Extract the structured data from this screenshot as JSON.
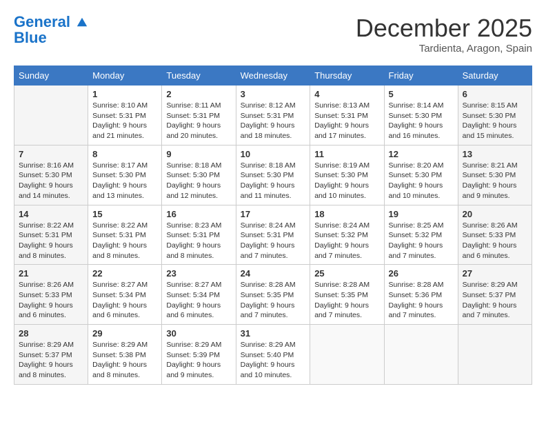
{
  "header": {
    "logo_line1": "General",
    "logo_line2": "Blue",
    "month": "December 2025",
    "location": "Tardienta, Aragon, Spain"
  },
  "weekdays": [
    "Sunday",
    "Monday",
    "Tuesday",
    "Wednesday",
    "Thursday",
    "Friday",
    "Saturday"
  ],
  "weeks": [
    [
      {
        "day": "",
        "sunrise": "",
        "sunset": "",
        "daylight": ""
      },
      {
        "day": "1",
        "sunrise": "Sunrise: 8:10 AM",
        "sunset": "Sunset: 5:31 PM",
        "daylight": "Daylight: 9 hours and 21 minutes."
      },
      {
        "day": "2",
        "sunrise": "Sunrise: 8:11 AM",
        "sunset": "Sunset: 5:31 PM",
        "daylight": "Daylight: 9 hours and 20 minutes."
      },
      {
        "day": "3",
        "sunrise": "Sunrise: 8:12 AM",
        "sunset": "Sunset: 5:31 PM",
        "daylight": "Daylight: 9 hours and 18 minutes."
      },
      {
        "day": "4",
        "sunrise": "Sunrise: 8:13 AM",
        "sunset": "Sunset: 5:31 PM",
        "daylight": "Daylight: 9 hours and 17 minutes."
      },
      {
        "day": "5",
        "sunrise": "Sunrise: 8:14 AM",
        "sunset": "Sunset: 5:30 PM",
        "daylight": "Daylight: 9 hours and 16 minutes."
      },
      {
        "day": "6",
        "sunrise": "Sunrise: 8:15 AM",
        "sunset": "Sunset: 5:30 PM",
        "daylight": "Daylight: 9 hours and 15 minutes."
      }
    ],
    [
      {
        "day": "7",
        "sunrise": "Sunrise: 8:16 AM",
        "sunset": "Sunset: 5:30 PM",
        "daylight": "Daylight: 9 hours and 14 minutes."
      },
      {
        "day": "8",
        "sunrise": "Sunrise: 8:17 AM",
        "sunset": "Sunset: 5:30 PM",
        "daylight": "Daylight: 9 hours and 13 minutes."
      },
      {
        "day": "9",
        "sunrise": "Sunrise: 8:18 AM",
        "sunset": "Sunset: 5:30 PM",
        "daylight": "Daylight: 9 hours and 12 minutes."
      },
      {
        "day": "10",
        "sunrise": "Sunrise: 8:18 AM",
        "sunset": "Sunset: 5:30 PM",
        "daylight": "Daylight: 9 hours and 11 minutes."
      },
      {
        "day": "11",
        "sunrise": "Sunrise: 8:19 AM",
        "sunset": "Sunset: 5:30 PM",
        "daylight": "Daylight: 9 hours and 10 minutes."
      },
      {
        "day": "12",
        "sunrise": "Sunrise: 8:20 AM",
        "sunset": "Sunset: 5:30 PM",
        "daylight": "Daylight: 9 hours and 10 minutes."
      },
      {
        "day": "13",
        "sunrise": "Sunrise: 8:21 AM",
        "sunset": "Sunset: 5:30 PM",
        "daylight": "Daylight: 9 hours and 9 minutes."
      }
    ],
    [
      {
        "day": "14",
        "sunrise": "Sunrise: 8:22 AM",
        "sunset": "Sunset: 5:31 PM",
        "daylight": "Daylight: 9 hours and 8 minutes."
      },
      {
        "day": "15",
        "sunrise": "Sunrise: 8:22 AM",
        "sunset": "Sunset: 5:31 PM",
        "daylight": "Daylight: 9 hours and 8 minutes."
      },
      {
        "day": "16",
        "sunrise": "Sunrise: 8:23 AM",
        "sunset": "Sunset: 5:31 PM",
        "daylight": "Daylight: 9 hours and 8 minutes."
      },
      {
        "day": "17",
        "sunrise": "Sunrise: 8:24 AM",
        "sunset": "Sunset: 5:31 PM",
        "daylight": "Daylight: 9 hours and 7 minutes."
      },
      {
        "day": "18",
        "sunrise": "Sunrise: 8:24 AM",
        "sunset": "Sunset: 5:32 PM",
        "daylight": "Daylight: 9 hours and 7 minutes."
      },
      {
        "day": "19",
        "sunrise": "Sunrise: 8:25 AM",
        "sunset": "Sunset: 5:32 PM",
        "daylight": "Daylight: 9 hours and 7 minutes."
      },
      {
        "day": "20",
        "sunrise": "Sunrise: 8:26 AM",
        "sunset": "Sunset: 5:33 PM",
        "daylight": "Daylight: 9 hours and 6 minutes."
      }
    ],
    [
      {
        "day": "21",
        "sunrise": "Sunrise: 8:26 AM",
        "sunset": "Sunset: 5:33 PM",
        "daylight": "Daylight: 9 hours and 6 minutes."
      },
      {
        "day": "22",
        "sunrise": "Sunrise: 8:27 AM",
        "sunset": "Sunset: 5:34 PM",
        "daylight": "Daylight: 9 hours and 6 minutes."
      },
      {
        "day": "23",
        "sunrise": "Sunrise: 8:27 AM",
        "sunset": "Sunset: 5:34 PM",
        "daylight": "Daylight: 9 hours and 6 minutes."
      },
      {
        "day": "24",
        "sunrise": "Sunrise: 8:28 AM",
        "sunset": "Sunset: 5:35 PM",
        "daylight": "Daylight: 9 hours and 7 minutes."
      },
      {
        "day": "25",
        "sunrise": "Sunrise: 8:28 AM",
        "sunset": "Sunset: 5:35 PM",
        "daylight": "Daylight: 9 hours and 7 minutes."
      },
      {
        "day": "26",
        "sunrise": "Sunrise: 8:28 AM",
        "sunset": "Sunset: 5:36 PM",
        "daylight": "Daylight: 9 hours and 7 minutes."
      },
      {
        "day": "27",
        "sunrise": "Sunrise: 8:29 AM",
        "sunset": "Sunset: 5:37 PM",
        "daylight": "Daylight: 9 hours and 7 minutes."
      }
    ],
    [
      {
        "day": "28",
        "sunrise": "Sunrise: 8:29 AM",
        "sunset": "Sunset: 5:37 PM",
        "daylight": "Daylight: 9 hours and 8 minutes."
      },
      {
        "day": "29",
        "sunrise": "Sunrise: 8:29 AM",
        "sunset": "Sunset: 5:38 PM",
        "daylight": "Daylight: 9 hours and 8 minutes."
      },
      {
        "day": "30",
        "sunrise": "Sunrise: 8:29 AM",
        "sunset": "Sunset: 5:39 PM",
        "daylight": "Daylight: 9 hours and 9 minutes."
      },
      {
        "day": "31",
        "sunrise": "Sunrise: 8:29 AM",
        "sunset": "Sunset: 5:40 PM",
        "daylight": "Daylight: 9 hours and 10 minutes."
      },
      {
        "day": "",
        "sunrise": "",
        "sunset": "",
        "daylight": ""
      },
      {
        "day": "",
        "sunrise": "",
        "sunset": "",
        "daylight": ""
      },
      {
        "day": "",
        "sunrise": "",
        "sunset": "",
        "daylight": ""
      }
    ]
  ]
}
